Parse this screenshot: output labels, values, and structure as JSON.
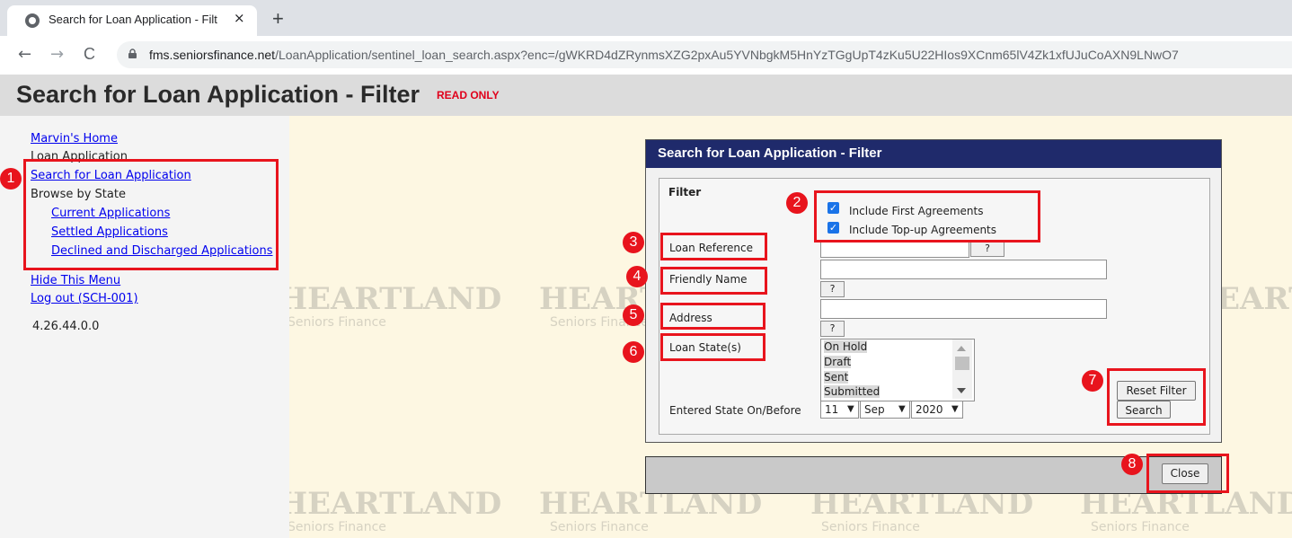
{
  "browser": {
    "tab_title": "Search for Loan Application - Filt",
    "tab_close": "×",
    "new_tab": "+",
    "url_domain": "fms.seniorsfinance.net",
    "url_path": "/LoanApplication/sentinel_loan_search.aspx?enc=/gWKRD4dZRynmsXZG2pxAu5YVNbgkM5HnYzTGgUpT4zKu5U22HIos9XCnm65lV4Zk1xfUJuCoAXN9LNwO7",
    "back": "←",
    "forward": "→",
    "reload": "C"
  },
  "header": {
    "title": "Search for Loan Application - Filter",
    "badge": "READ ONLY"
  },
  "sidebar": {
    "home": "Marvin's Home",
    "section": "Loan Application",
    "search": "Search for Loan Application",
    "browse": "Browse by State",
    "current": "Current Applications",
    "settled": "Settled Applications",
    "declined": "Declined and Discharged Applications",
    "hide_menu": "Hide This Menu",
    "logout": "Log out (SCH-001)",
    "version": "4.26.44.0.0"
  },
  "watermark": {
    "brand": "HEARTLAND",
    "sub": "Seniors Finance"
  },
  "dialog": {
    "title": "Search for Loan Application - Filter",
    "filter_label": "Filter",
    "include_first": "Include First Agreements",
    "include_topup": "Include Top-up Agreements",
    "loan_reference": "Loan Reference",
    "friendly_name": "Friendly Name",
    "address": "Address",
    "loan_states": "Loan State(s)",
    "help": "?",
    "states": [
      "On Hold",
      "Draft",
      "Sent",
      "Submitted"
    ],
    "entered_state": "Entered State On/Before",
    "day": "11",
    "month": "Sep",
    "year": "2020",
    "reset": "Reset Filter",
    "search": "Search",
    "close": "Close"
  },
  "annotations": [
    "1",
    "2",
    "3",
    "4",
    "5",
    "6",
    "7",
    "8"
  ],
  "colors": {
    "annotation": "#e8141d",
    "dialog_header": "#1f2a6b",
    "read_only": "#e0001b",
    "main_bg": "#fdf7e2"
  }
}
